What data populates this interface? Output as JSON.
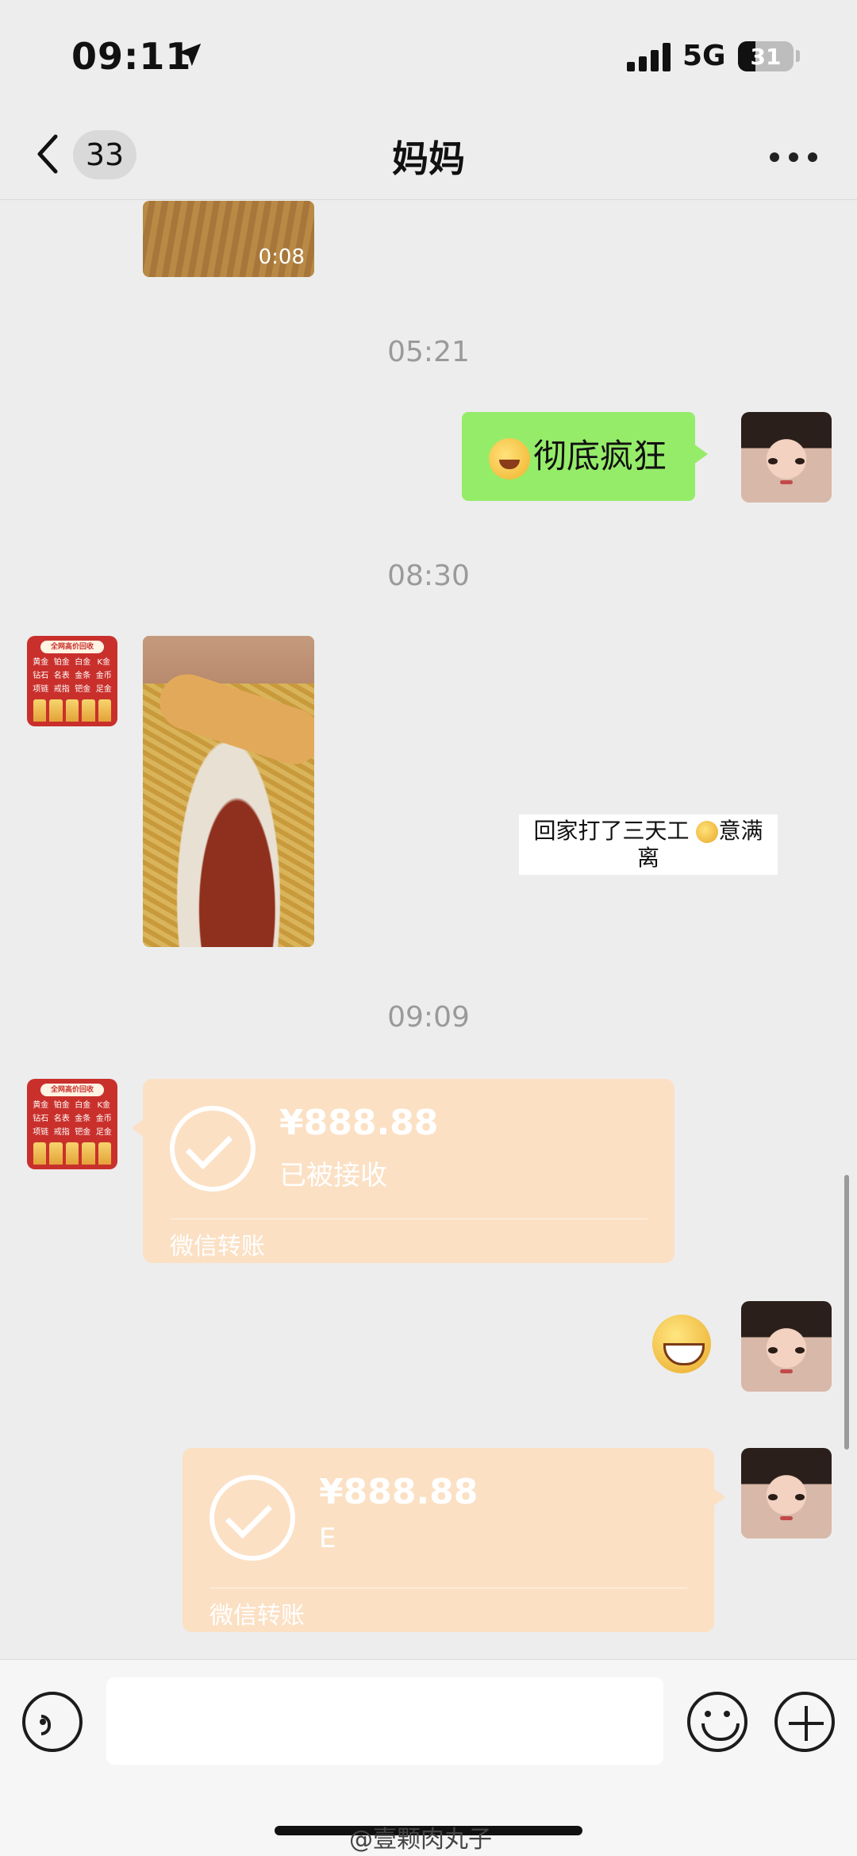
{
  "status_bar": {
    "time": "09:11",
    "network": "5G",
    "battery": "31",
    "signal_bars": 4
  },
  "nav": {
    "unread_count": "33",
    "title": "妈妈"
  },
  "messages": {
    "video_duration": "0:08",
    "timestamp_1": "05:21",
    "self_text": "彻底疯狂",
    "timestamp_2": "08:30",
    "card_text_1": "回家打了三天工",
    "card_text_2": "意满",
    "card_text_3": "离",
    "timestamp_3": "09:09",
    "transfer_received": {
      "amount": "¥888.88",
      "status": "已被接收",
      "label": "微信转账"
    },
    "transfer_sent": {
      "amount": "¥888.88",
      "status": "E",
      "label": "微信转账"
    }
  },
  "mom_avatar": {
    "header": "全网高价回收",
    "grid": [
      "黄金",
      "铂金",
      "白金",
      "K金",
      "钻石",
      "名表",
      "金条",
      "金币",
      "项链",
      "戒指",
      "钯金",
      "足金"
    ]
  },
  "watermark": "@壹颗肉丸子",
  "colors": {
    "background": "#ededed",
    "self_bubble": "#95ec69",
    "transfer_bubble": "#fbe0c4"
  }
}
